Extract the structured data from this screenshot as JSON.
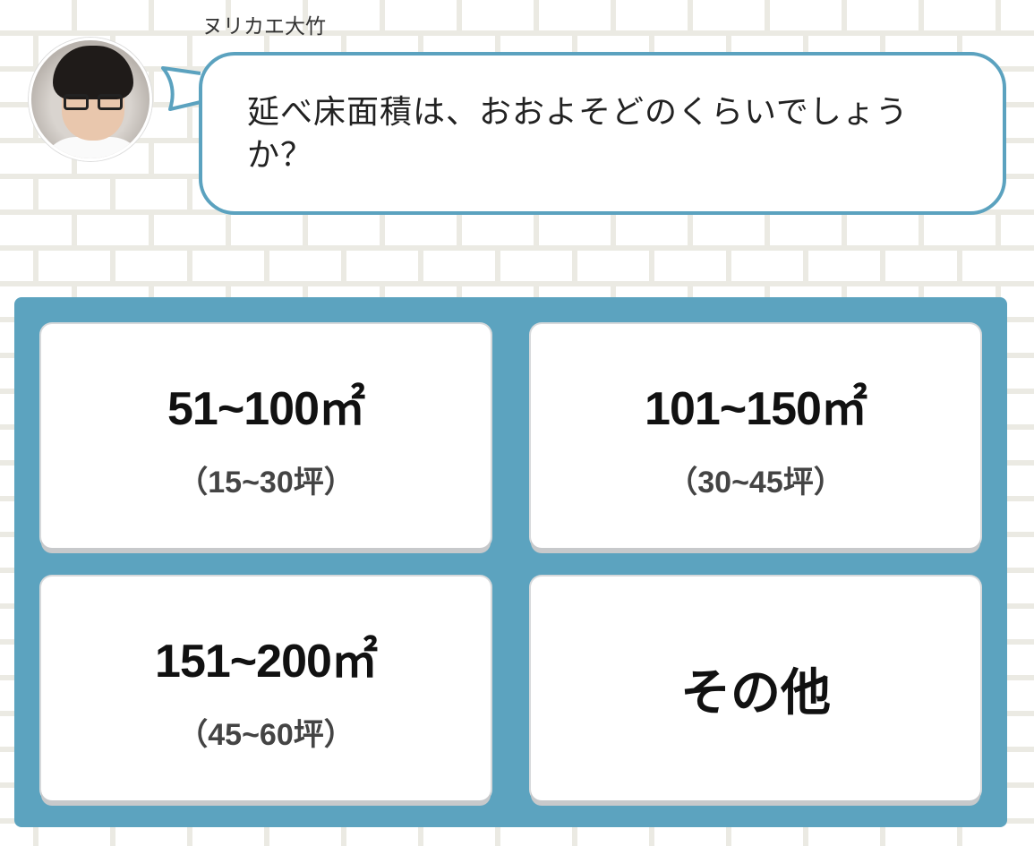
{
  "speaker": {
    "name": "ヌリカエ大竹"
  },
  "question": {
    "text": "延べ床面積は、おおよそどのくらいでしょうか？"
  },
  "options": [
    {
      "main": "51~100㎡",
      "sub": "（15~30坪）"
    },
    {
      "main": "101~150㎡",
      "sub": "（30~45坪）"
    },
    {
      "main": "151~200㎡",
      "sub": "（45~60坪）"
    },
    {
      "main": "その他"
    }
  ],
  "colors": {
    "panel": "#5ca3bf",
    "bubble_border": "#5ba2bf"
  }
}
